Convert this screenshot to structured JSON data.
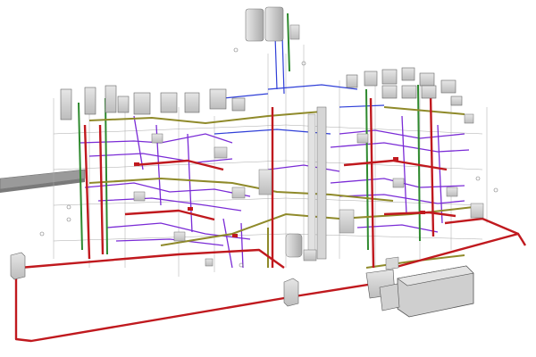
{
  "scene": {
    "description_kind": "bim-mep-model-view",
    "colors": {
      "background": "#ffffff",
      "pipe_red": "#c0191e",
      "pipe_olive": "#8f8a2a",
      "pipe_green": "#2f8a2f",
      "pipe_purple": "#7a2bd6",
      "pipe_blue": "#2f3fd8",
      "equipment_fill": "#d9d9d9",
      "equipment_edge": "#6f6f6f",
      "frame_line": "#9a9a9a",
      "duct_gray": "#8c8c8c"
    }
  }
}
